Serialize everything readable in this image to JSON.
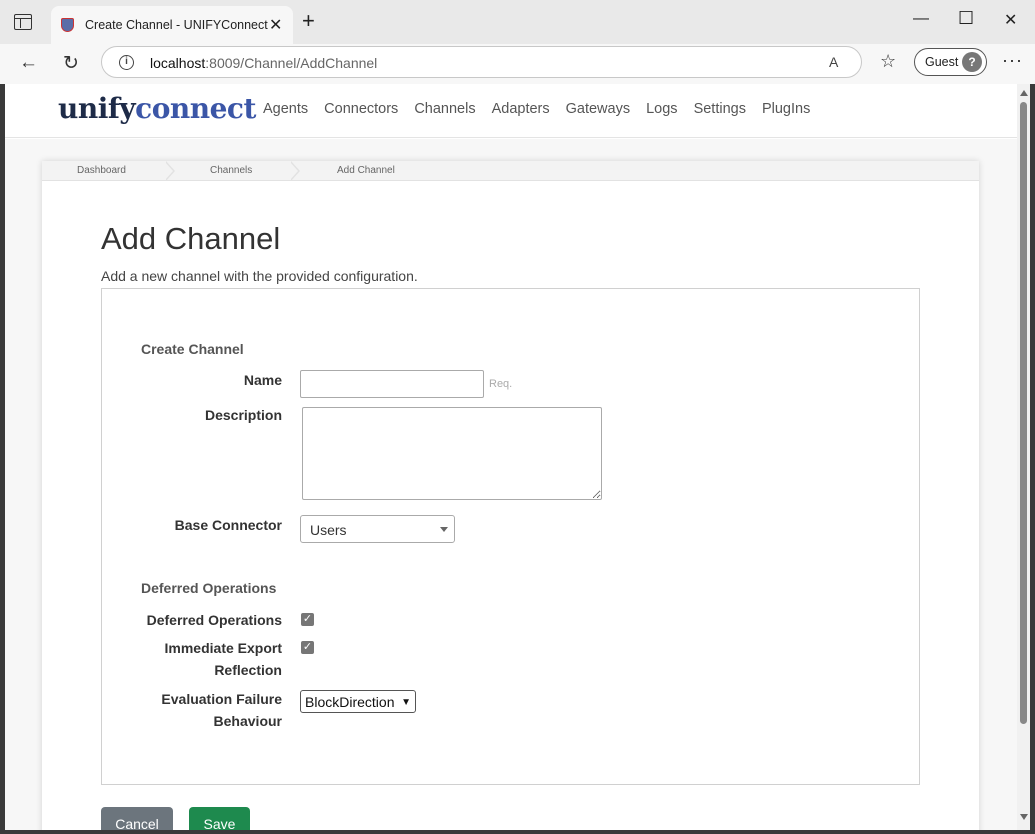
{
  "browser": {
    "tab_title": "Create Channel - UNIFYConnect",
    "url_host": "localhost",
    "url_path": ":8009/Channel/AddChannel",
    "profile_label": "Guest",
    "icons": [
      "tab-actions-icon",
      "site-favicon",
      "close-icon",
      "new-tab-icon",
      "minimize-icon",
      "maximize-icon",
      "close-window-icon",
      "back-icon",
      "reload-icon",
      "info-icon",
      "read-aloud-icon",
      "favorites-icon",
      "profile-avatar-icon",
      "more-menu-icon"
    ]
  },
  "site": {
    "logo_part1": "unify",
    "logo_part2": "connect",
    "nav": [
      "Agents",
      "Connectors",
      "Channels",
      "Adapters",
      "Gateways",
      "Logs",
      "Settings",
      "PlugIns"
    ]
  },
  "breadcrumb": [
    "Dashboard",
    "Channels",
    "Add Channel"
  ],
  "page": {
    "title": "Add Channel",
    "description": "Add a new channel with the provided configuration."
  },
  "form": {
    "section1_title": "Create Channel",
    "name_label": "Name",
    "name_value": "",
    "name_hint": "Req.",
    "description_label": "Description",
    "description_value": "",
    "base_connector_label": "Base Connector",
    "base_connector_value": "Users",
    "section2_title": "Deferred Operations",
    "deferred_ops_label": "Deferred Operations",
    "deferred_ops_checked": true,
    "immediate_export_label_1": "Immediate Export",
    "immediate_export_label_2": "Reflection",
    "immediate_export_checked": true,
    "eval_failure_label_1": "Evaluation Failure",
    "eval_failure_label_2": "Behaviour",
    "eval_failure_value": "BlockDirection"
  },
  "actions": {
    "cancel_label": "Cancel",
    "save_label": "Save"
  },
  "colors": {
    "save": "#1e8a4e",
    "cancel": "#6c757d",
    "logo_dark": "#1e2b48",
    "logo_accent": "#3b56a7"
  }
}
